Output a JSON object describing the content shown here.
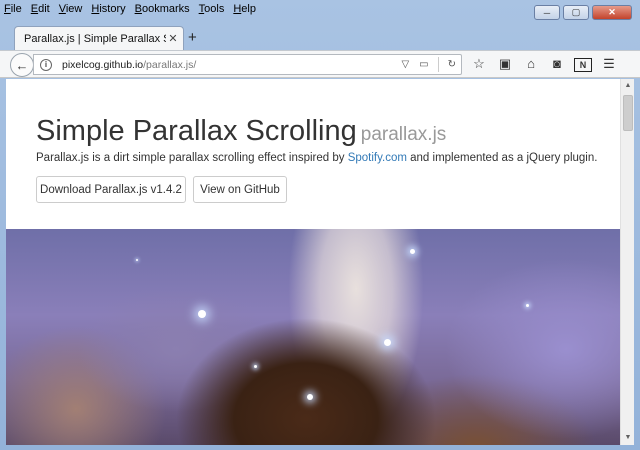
{
  "menubar": {
    "items": [
      "File",
      "Edit",
      "View",
      "History",
      "Bookmarks",
      "Tools",
      "Help"
    ],
    "underlined": [
      "F",
      "E",
      "V",
      "H",
      "B",
      "T",
      "H"
    ]
  },
  "window_controls": {
    "minimize": "─",
    "maximize": "▢",
    "close": "✕"
  },
  "tab": {
    "title": "Parallax.js | Simple Parallax Scro...",
    "close": "✕",
    "new_tab": "+"
  },
  "urlbar": {
    "info_glyph": "i",
    "host": "pixelcog.github.io",
    "path": "/parallax.js/",
    "dropdown": "▽",
    "reader": "▭",
    "reload": "↻"
  },
  "toolbar_icons": [
    "star-icon",
    "clipboard-icon",
    "home-icon",
    "pocket-icon",
    "onenote-icon",
    "menu-icon"
  ],
  "toolbar_glyphs": [
    "☆",
    "▣",
    "⌂",
    "◙",
    "N",
    "☰"
  ],
  "page": {
    "title": "Simple Parallax Scrolling",
    "title_small": "parallax.js",
    "lead_before": "Parallax.js is a dirt simple parallax scrolling effect inspired by ",
    "lead_link": "Spotify.com",
    "lead_after": " and implemented as a jQuery plugin.",
    "download_button": "Download Parallax.js v1.4.2",
    "github_button": "View on GitHub"
  },
  "colors": {
    "link": "#337ab7",
    "title": "#333333",
    "title_small": "#999999"
  },
  "scrollbar": {
    "up": "▲",
    "down": "▼",
    "position": 0.02
  }
}
